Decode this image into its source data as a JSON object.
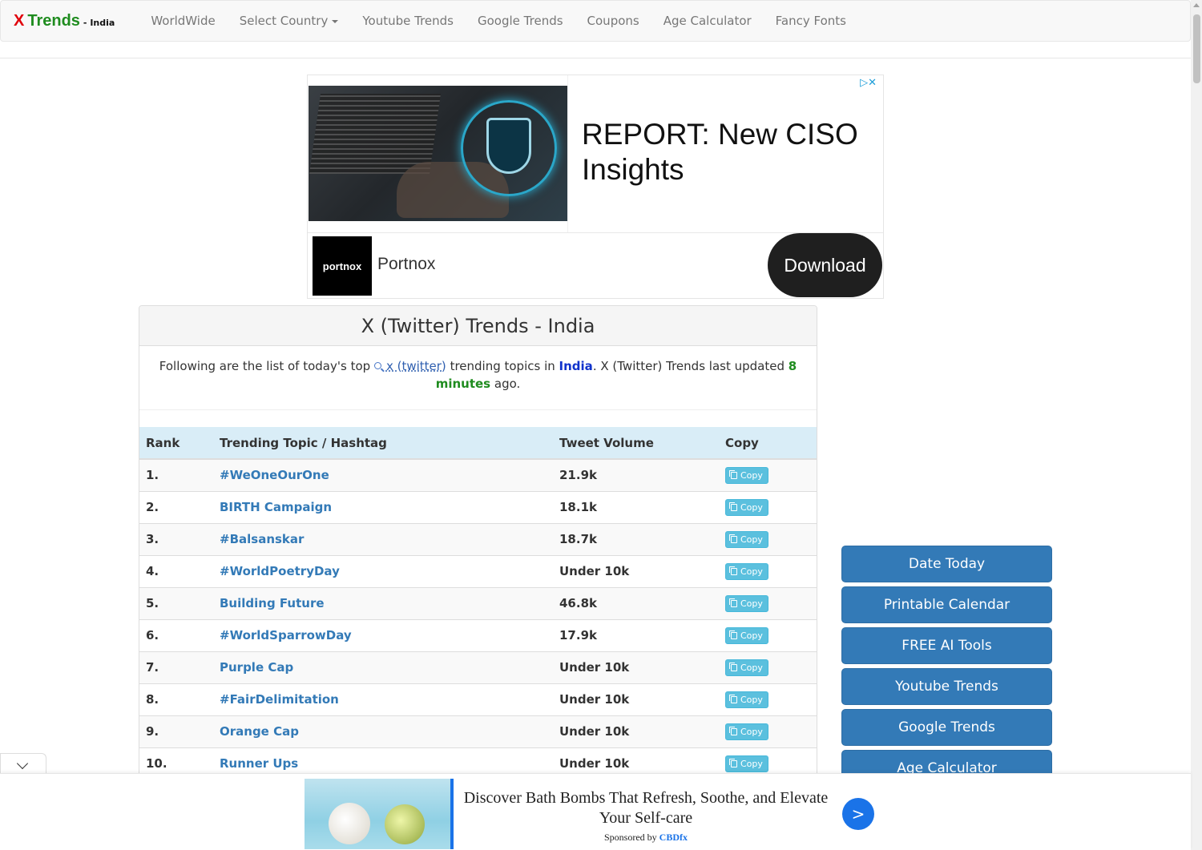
{
  "brand": {
    "x": "X",
    "trends": "Trends",
    "sub": "- India"
  },
  "nav": [
    {
      "label": "WorldWide"
    },
    {
      "label": "Select Country",
      "dropdown": true
    },
    {
      "label": "Youtube Trends"
    },
    {
      "label": "Google Trends"
    },
    {
      "label": "Coupons"
    },
    {
      "label": "Age Calculator"
    },
    {
      "label": "Fancy Fonts"
    }
  ],
  "top_ad": {
    "headline": "REPORT: New CISO Insights",
    "logo": "portnox",
    "brand": "Portnox",
    "cta": "Download",
    "adchoices": "▷✕"
  },
  "panel": {
    "title": "X (Twitter) Trends - India",
    "intro_prefix": "Following are the list of today's top",
    "intro_link": "x (twitter)",
    "intro_mid": "trending topics in",
    "country": "India",
    "intro_suffix": ". X (Twitter) Trends last updated",
    "updated": "8 minutes",
    "intro_end": "ago."
  },
  "table": {
    "headers": {
      "rank": "Rank",
      "topic": "Trending Topic / Hashtag",
      "volume": "Tweet Volume",
      "copy": "Copy"
    },
    "copy_label": "Copy",
    "rows": [
      {
        "rank": "1.",
        "topic": "#WeOneOurOne",
        "volume": "21.9k"
      },
      {
        "rank": "2.",
        "topic": "BIRTH Campaign",
        "volume": "18.1k"
      },
      {
        "rank": "3.",
        "topic": "#Balsanskar",
        "volume": "18.7k"
      },
      {
        "rank": "4.",
        "topic": "#WorldPoetryDay",
        "volume": "Under 10k"
      },
      {
        "rank": "5.",
        "topic": "Building Future",
        "volume": "46.8k"
      },
      {
        "rank": "6.",
        "topic": "#WorldSparrowDay",
        "volume": "17.9k"
      },
      {
        "rank": "7.",
        "topic": "Purple Cap",
        "volume": "Under 10k"
      },
      {
        "rank": "8.",
        "topic": "#FairDelimitation",
        "volume": "Under 10k"
      },
      {
        "rank": "9.",
        "topic": "Orange Cap",
        "volume": "Under 10k"
      },
      {
        "rank": "10.",
        "topic": "Runner Ups",
        "volume": "Under 10k"
      }
    ]
  },
  "sidebar": {
    "buttons": [
      {
        "label": "Date Today"
      },
      {
        "label": "Printable Calendar"
      },
      {
        "label": "FREE AI Tools"
      },
      {
        "label": "Youtube Trends"
      },
      {
        "label": "Google Trends"
      },
      {
        "label": "Age Calculator"
      }
    ]
  },
  "bottom_ad": {
    "headline": "Discover Bath Bombs That Refresh, Soothe, and Elevate Your Self-care",
    "sponsored_prefix": "Sponsored by",
    "sponsor": "CBDfx",
    "go": ">"
  },
  "colors": {
    "brand_red": "#e0000a",
    "brand_green": "#1f8c1f",
    "primary": "#337ab7",
    "info": "#5bc0de",
    "header_bg": "#d9edf7"
  }
}
